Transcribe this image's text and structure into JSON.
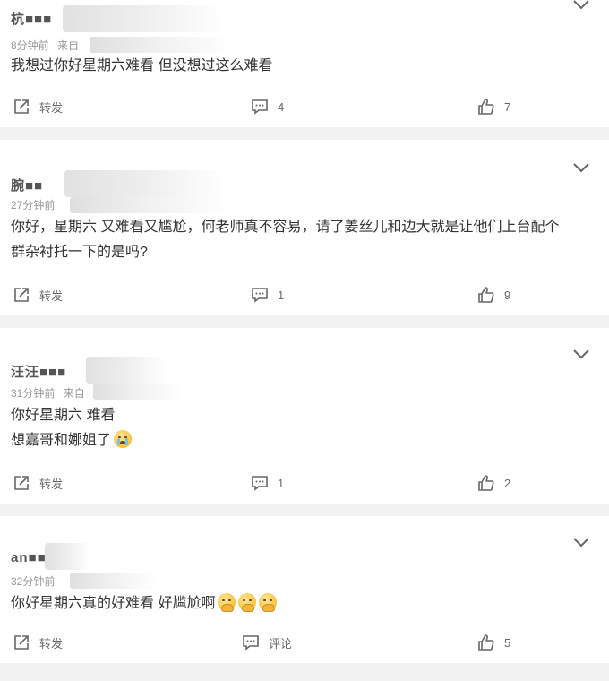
{
  "comments": [
    {
      "username": "杭■■■",
      "time": "8分钟前",
      "source_prefix": "来自",
      "lines": [
        "我想过你好星期六难看 但没想过这么难看"
      ],
      "emojis": 0,
      "emoji_type": "",
      "repost_label": "转发",
      "comment_label": "4",
      "like_count": "7"
    },
    {
      "username": "腕■■",
      "time": "27分钟前",
      "source_prefix": "",
      "lines": [
        "你好，星期六 又难看又尴尬，何老师真不容易，请了姜丝儿和边大就是让他们上台配个",
        "群杂衬托一下的是吗?"
      ],
      "emojis": 0,
      "emoji_type": "",
      "repost_label": "转发",
      "comment_label": "1",
      "like_count": "9"
    },
    {
      "username": "汪汪■■■",
      "time": "31分钟前",
      "source_prefix": "来自",
      "lines": [
        "你好星期六 难看",
        "想嘉哥和娜姐了"
      ],
      "emojis": 1,
      "emoji_type": "crying-face",
      "repost_label": "转发",
      "comment_label": "1",
      "like_count": "2"
    },
    {
      "username": "an■■",
      "time": "32分钟前",
      "source_prefix": "",
      "lines": [
        "你好星期六真的好难看 好尴尬啊"
      ],
      "emojis": 3,
      "emoji_type": "shushing-face",
      "repost_label": "转发",
      "comment_label": "评论",
      "like_count": "5"
    }
  ],
  "icons": {
    "repost": "share-arrow-icon",
    "comment": "speech-bubble-icon",
    "like": "thumbs-up-icon",
    "menu": "chevron-down-icon"
  },
  "colors": {
    "text": "#333333",
    "muted": "#999999",
    "icon": "#666666",
    "divider": "#f2f2f2"
  }
}
